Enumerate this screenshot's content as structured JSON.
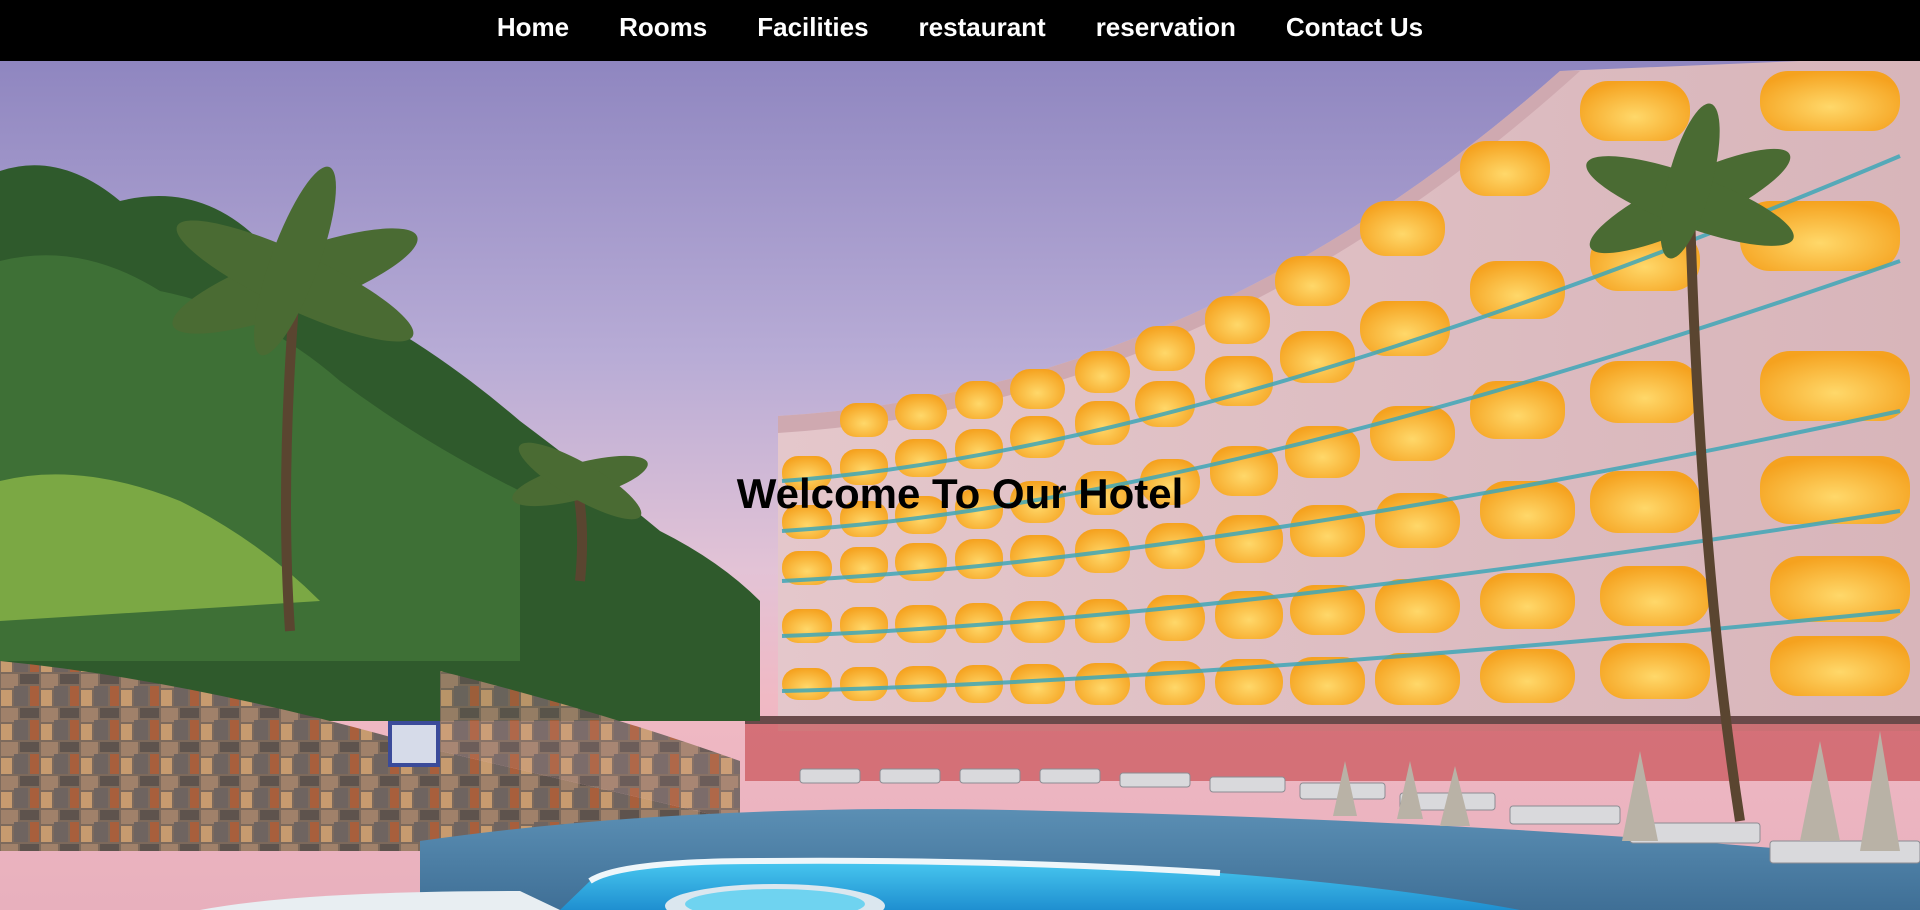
{
  "nav": {
    "items": [
      {
        "label": "Home"
      },
      {
        "label": "Rooms"
      },
      {
        "label": "Facilities"
      },
      {
        "label": "restaurant"
      },
      {
        "label": "reservation"
      },
      {
        "label": "Contact Us"
      }
    ]
  },
  "hero": {
    "title": "Welcome To Our Hotel"
  },
  "colors": {
    "navbar_background": "#000000",
    "nav_text": "#ffffff",
    "title_text": "#000000"
  }
}
